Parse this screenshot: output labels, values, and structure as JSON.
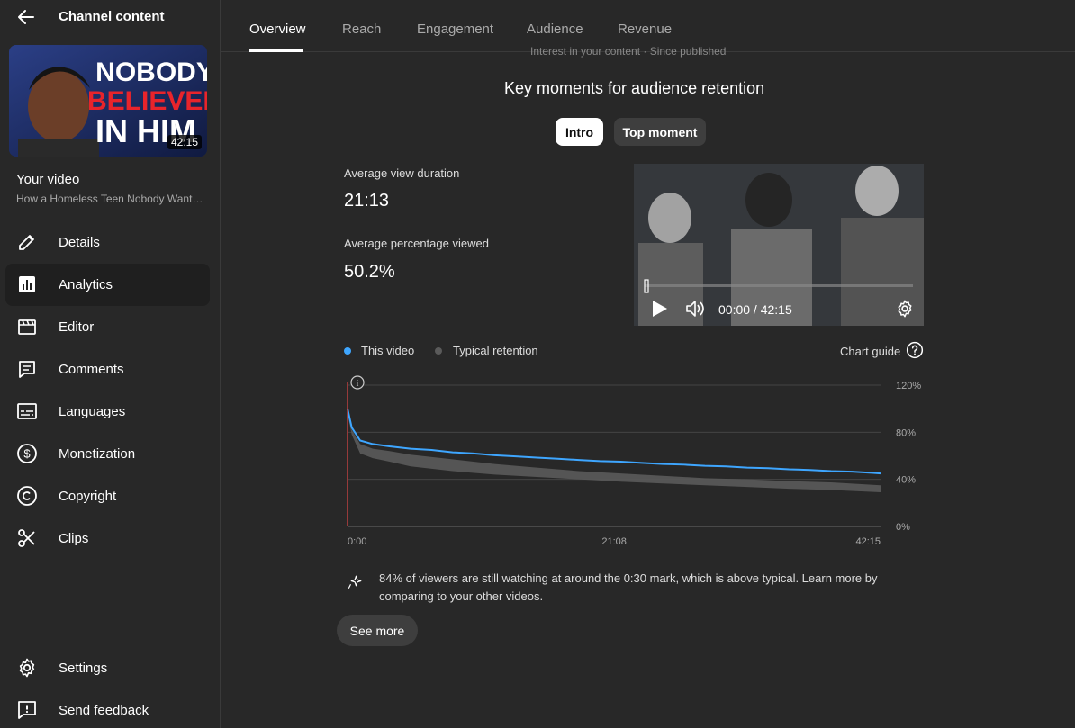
{
  "sidebar": {
    "title": "Channel content",
    "thumbnail": {
      "line1": "NOBODY",
      "line2": "BELIEVED",
      "line3": "IN HIM",
      "duration": "42:15"
    },
    "your_video_label": "Your video",
    "video_title": "How a Homeless Teen Nobody Wanted...",
    "items": [
      {
        "label": "Details",
        "icon": "pencil-icon"
      },
      {
        "label": "Analytics",
        "icon": "analytics-icon",
        "active": true
      },
      {
        "label": "Editor",
        "icon": "clapperboard-icon"
      },
      {
        "label": "Comments",
        "icon": "comment-icon"
      },
      {
        "label": "Languages",
        "icon": "subtitles-icon"
      },
      {
        "label": "Monetization",
        "icon": "dollar-icon"
      },
      {
        "label": "Copyright",
        "icon": "copyright-icon"
      },
      {
        "label": "Clips",
        "icon": "scissors-icon"
      }
    ],
    "bottom_items": [
      {
        "label": "Settings",
        "icon": "gear-icon"
      },
      {
        "label": "Send feedback",
        "icon": "feedback-icon"
      }
    ]
  },
  "tabs": [
    {
      "label": "Overview",
      "active": true
    },
    {
      "label": "Reach"
    },
    {
      "label": "Engagement"
    },
    {
      "label": "Audience"
    },
    {
      "label": "Revenue"
    }
  ],
  "ghost_text": "Interest in your content · Since published",
  "section": {
    "title": "Key moments for audience retention",
    "chips": [
      "Intro",
      "Top moment"
    ]
  },
  "metrics": {
    "avg_view_duration_label": "Average view duration",
    "avg_view_duration_value": "21:13",
    "avg_pct_viewed_label": "Average percentage viewed",
    "avg_pct_viewed_value": "50.2%"
  },
  "player": {
    "time": "00:00 / 42:15"
  },
  "legend": {
    "this_video": "This video",
    "typical": "Typical retention",
    "chart_guide": "Chart guide"
  },
  "colors": {
    "this_video": "#3ea6ff",
    "typical": "#5a5a5a",
    "marker": "#e04848"
  },
  "chart_data": {
    "type": "line",
    "x_ticks": [
      "0:00",
      "21:08",
      "42:15"
    ],
    "y_ticks": [
      "120%",
      "80%",
      "40%",
      "0%"
    ],
    "ylim": [
      0,
      120
    ],
    "x_range_seconds": [
      0,
      2535
    ],
    "series": [
      {
        "name": "This video",
        "x": [
          0,
          20,
          60,
          120,
          200,
          300,
          400,
          500,
          600,
          700,
          800,
          900,
          1000,
          1100,
          1200,
          1300,
          1400,
          1500,
          1600,
          1700,
          1800,
          1900,
          2000,
          2100,
          2200,
          2300,
          2400,
          2500,
          2535
        ],
        "y": [
          100,
          84,
          73,
          70,
          68,
          66,
          65,
          63,
          62,
          60.5,
          59.5,
          58.5,
          57.5,
          56.5,
          55.5,
          55,
          54,
          53,
          52.5,
          51.5,
          51,
          50,
          49.5,
          48.5,
          48,
          47,
          46.5,
          45.5,
          45
        ]
      }
    ],
    "typical_band": {
      "name": "Typical retention",
      "x": [
        0,
        20,
        60,
        120,
        200,
        300,
        500,
        700,
        900,
        1100,
        1300,
        1500,
        1700,
        1900,
        2100,
        2300,
        2535
      ],
      "upper": [
        98,
        82,
        70,
        66,
        64,
        61,
        57,
        53,
        50,
        47,
        45,
        43,
        41,
        40,
        38.5,
        37.5,
        35
      ],
      "lower": [
        96,
        78,
        62,
        58,
        55,
        51,
        47,
        44,
        42,
        40,
        38,
        36.5,
        35,
        33.5,
        32,
        31,
        29
      ]
    }
  },
  "insight": {
    "text": "84% of viewers are still watching at around the 0:30 mark, which is above typical. Learn more by comparing to your other videos.",
    "see_more": "See more"
  }
}
